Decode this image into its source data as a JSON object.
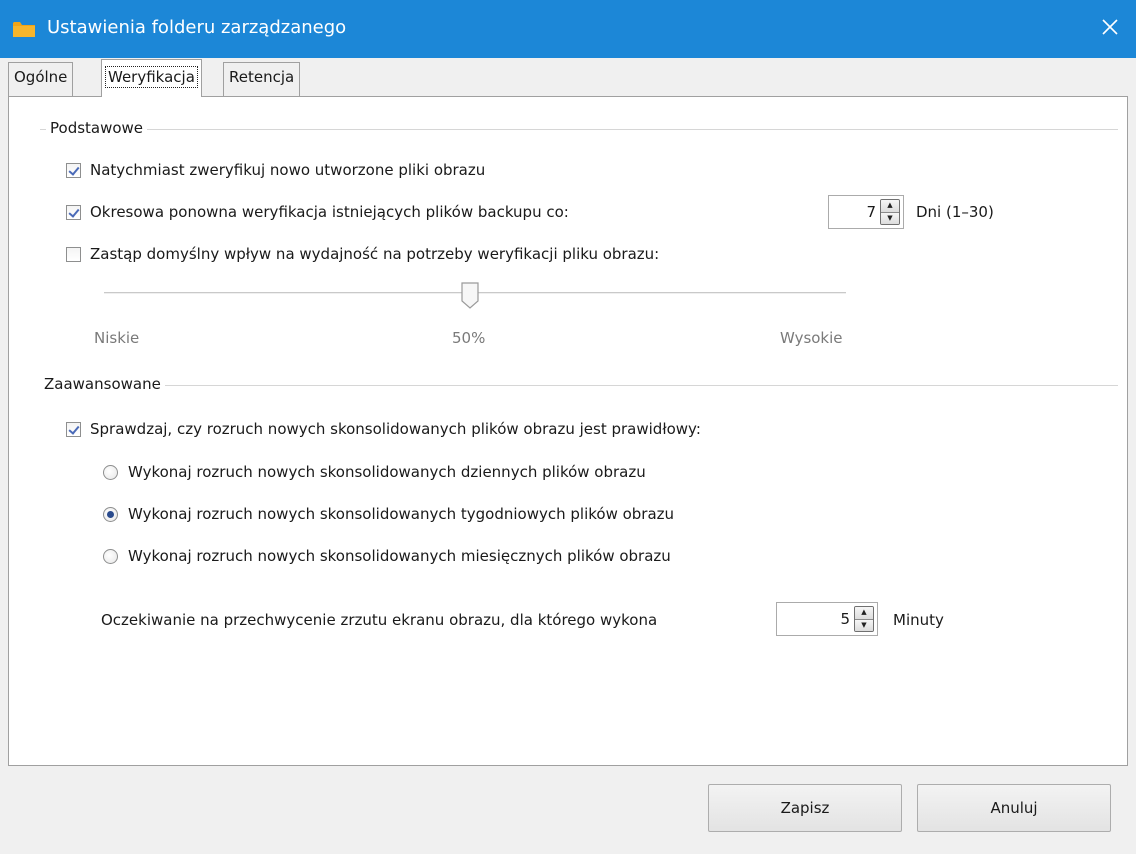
{
  "window": {
    "title": "Ustawienia folderu zarządzanego",
    "icon": "folder-icon",
    "close": "close-icon"
  },
  "tabs": [
    {
      "label": "Ogólne",
      "active": false
    },
    {
      "label": "Weryfikacja",
      "active": true
    },
    {
      "label": "Retencja",
      "active": false
    }
  ],
  "basic": {
    "group_label": "Podstawowe",
    "verify_new": {
      "label": "Natychmiast zweryfikuj nowo utworzone pliki obrazu",
      "checked": true
    },
    "periodic": {
      "label": "Okresowa ponowna weryfikacja istniejących plików backupu co:",
      "checked": true,
      "value": "7",
      "unit": "Dni (1–30)"
    },
    "override": {
      "label": "Zastąp domyślny wpływ na wydajność na potrzeby weryfikacji pliku obrazu:",
      "checked": false
    },
    "slider": {
      "value_percent": 50,
      "low_label": "Niskie",
      "mid_label": "50%",
      "high_label": "Wysokie"
    }
  },
  "advanced": {
    "group_label": "Zaawansowane",
    "boot_check": {
      "label": "Sprawdzaj, czy rozruch nowych skonsolidowanych plików obrazu jest prawidłowy:",
      "checked": true
    },
    "options": [
      {
        "label": "Wykonaj rozruch nowych skonsolidowanych dziennych plików obrazu",
        "selected": false
      },
      {
        "label": "Wykonaj rozruch nowych skonsolidowanych tygodniowych plików obrazu",
        "selected": true
      },
      {
        "label": "Wykonaj rozruch nowych skonsolidowanych miesięcznych plików obrazu",
        "selected": false
      }
    ],
    "wait": {
      "label": "Oczekiwanie na przechwycenie zrzutu ekranu obrazu, dla którego wykona",
      "value": "5",
      "unit": "Minuty"
    }
  },
  "footer": {
    "save": "Zapisz",
    "cancel": "Anuluj"
  },
  "colors": {
    "titlebar": "#1c87d7",
    "folder_icon": "#f0a417"
  }
}
